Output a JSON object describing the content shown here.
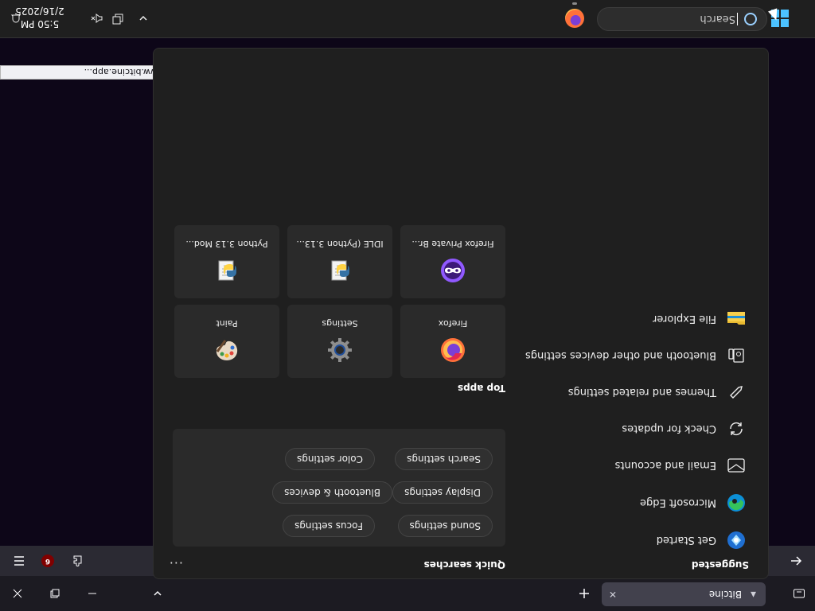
{
  "browser": {
    "tab_title": "Bitcine",
    "status_tip": "Looked up www.bitcine.app..."
  },
  "ublock": {
    "count": "6"
  },
  "taskbar": {
    "search_text": "Search",
    "time": "5:50 PM",
    "date": "2/16/2025"
  },
  "flyout": {
    "suggested_title": "Suggested",
    "suggested": [
      {
        "label": "Get Started",
        "icon": "get-started-icon"
      },
      {
        "label": "Microsoft Edge",
        "icon": "edge-icon"
      },
      {
        "label": "Email and accounts",
        "icon": "mail-icon"
      },
      {
        "label": "Check for updates",
        "icon": "refresh-icon"
      },
      {
        "label": "Themes and related settings",
        "icon": "pen-icon"
      },
      {
        "label": "Bluetooth and other devices settings",
        "icon": "devices-icon"
      },
      {
        "label": "File Explorer",
        "icon": "folder-icon"
      }
    ],
    "quick_title": "Quick searches",
    "quick": [
      [
        "Sound settings",
        "Focus settings"
      ],
      [
        "Display settings",
        "Bluetooth & devices"
      ],
      [
        "Search settings",
        "Color settings"
      ]
    ],
    "top_apps_title": "Top apps",
    "top_apps": [
      [
        "Firefox",
        "Settings",
        "Paint"
      ],
      [
        "Firefox Private Br...",
        "IDLE (Python 3.13...",
        "Python 3.13 Mod..."
      ]
    ]
  }
}
